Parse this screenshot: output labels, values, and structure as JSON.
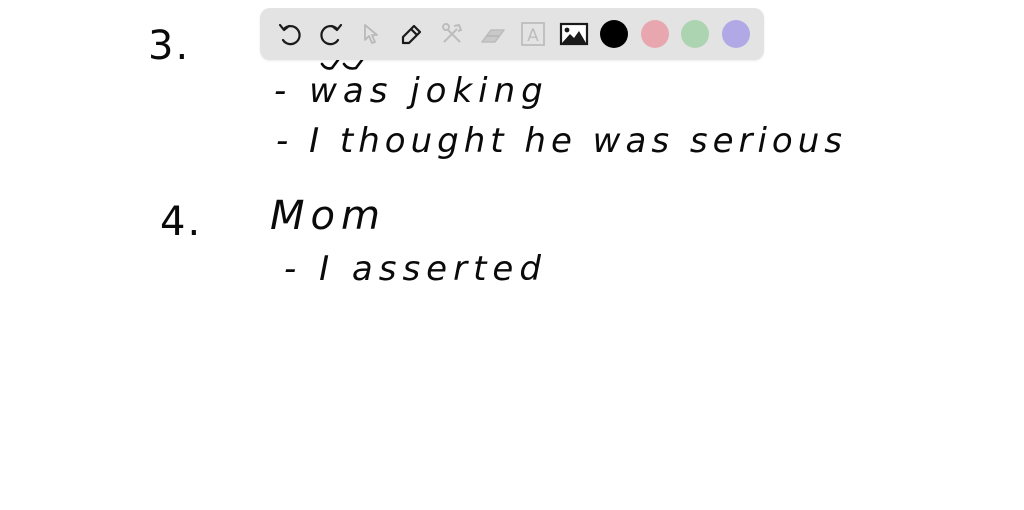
{
  "toolbar": {
    "tools": [
      {
        "name": "undo",
        "icon": "undo-icon",
        "enabled": true
      },
      {
        "name": "redo",
        "icon": "redo-icon",
        "enabled": true
      },
      {
        "name": "select",
        "icon": "cursor-icon",
        "enabled": false
      },
      {
        "name": "pen",
        "icon": "pencil-icon",
        "enabled": true
      },
      {
        "name": "tools",
        "icon": "hammer-wrench-icon",
        "enabled": false
      },
      {
        "name": "eraser",
        "icon": "eraser-icon",
        "enabled": false
      },
      {
        "name": "text",
        "icon": "text-box-icon",
        "enabled": false,
        "glyph": "A"
      },
      {
        "name": "image",
        "icon": "image-icon",
        "enabled": true
      }
    ],
    "colors": [
      {
        "name": "black",
        "hex": "#000000",
        "selected": true
      },
      {
        "name": "pink",
        "hex": "#e8a7ae",
        "selected": false
      },
      {
        "name": "green",
        "hex": "#acd4b1",
        "selected": false
      },
      {
        "name": "purple",
        "hex": "#b0a9e6",
        "selected": false
      }
    ]
  },
  "notes": {
    "item3": {
      "number": "3.",
      "bullets": [
        "- was  joking",
        "-  I   thought   he   was   serious"
      ]
    },
    "item4": {
      "number": "4.",
      "title": "Mom",
      "bullets": [
        "-  I    asserted"
      ]
    }
  }
}
